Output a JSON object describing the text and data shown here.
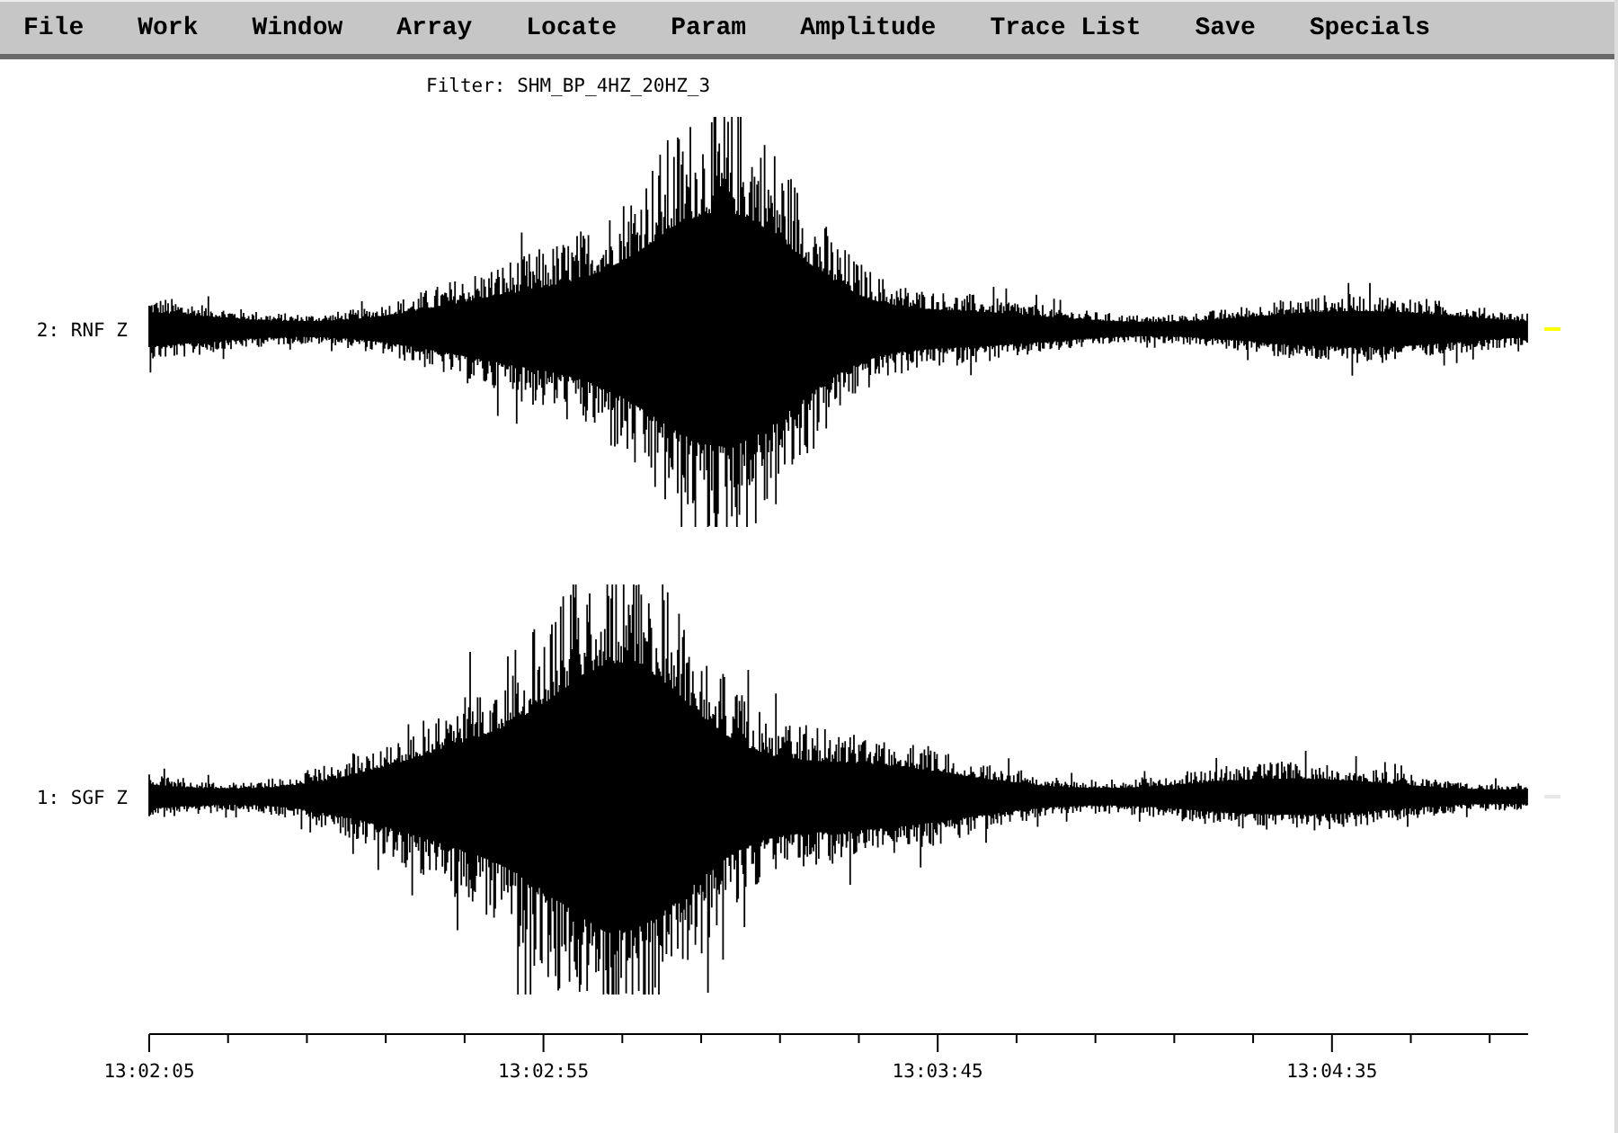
{
  "menu": [
    "File",
    "Work",
    "Window",
    "Array",
    "Locate",
    "Param",
    "Amplitude",
    "Trace List",
    "Save",
    "Specials"
  ],
  "filter_label": "Filter: SHM_BP_4HZ_20HZ_3",
  "traces": [
    {
      "label": "2: RNF Z",
      "selected": true
    },
    {
      "label": "1: SGF Z",
      "selected": false
    }
  ],
  "time_axis": {
    "ticks": [
      "13:02:05",
      "13:02:55",
      "13:03:45",
      "13:04:35"
    ]
  }
}
